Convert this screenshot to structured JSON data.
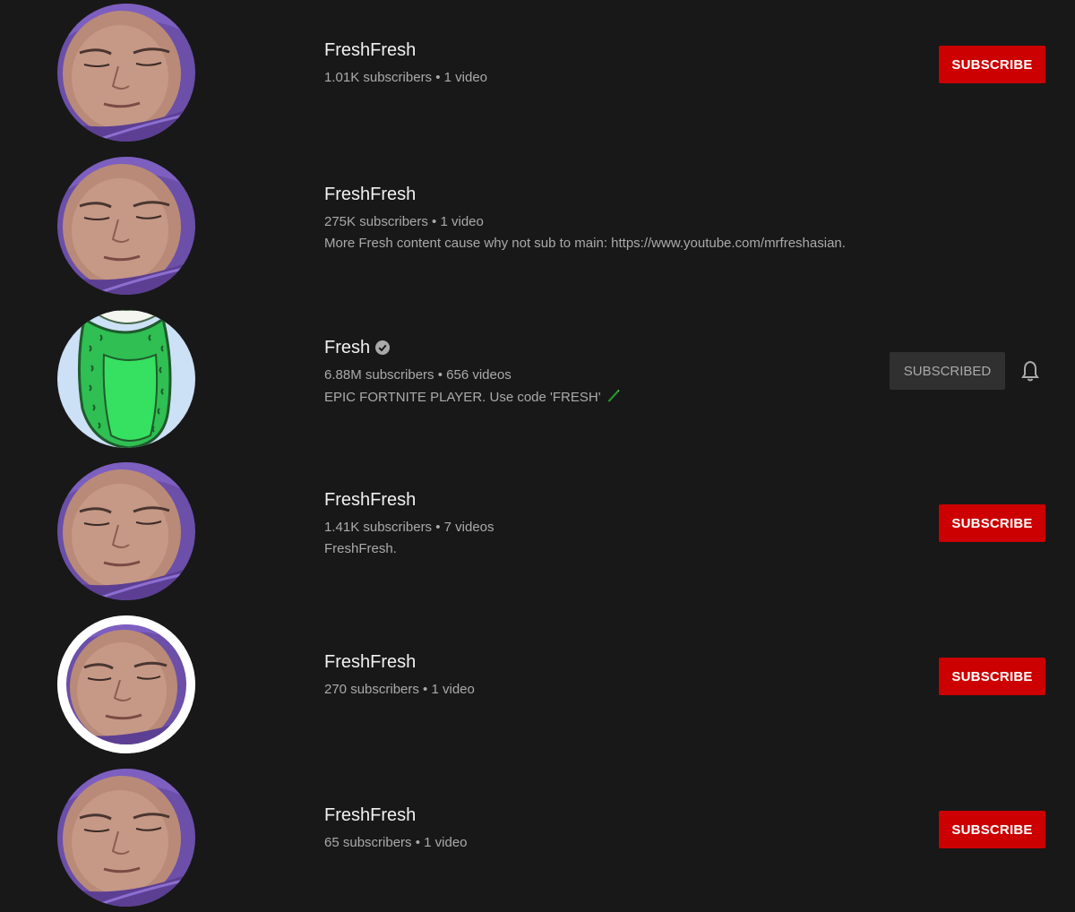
{
  "channels": [
    {
      "name": "FreshFresh",
      "meta": "1.01K subscribers • 1 video",
      "description": "",
      "button": "SUBSCRIBE",
      "avatar": "face-avatar"
    },
    {
      "name": "FreshFresh",
      "meta": "275K subscribers • 1 video",
      "description": "More Fresh content cause why not sub to main: https://www.youtube.com/mrfreshasian.",
      "button": "SUBSCRIBE",
      "avatar": "face-avatar"
    },
    {
      "name": "Fresh",
      "verified": true,
      "meta": "6.88M subscribers • 656 videos",
      "description": "EPIC FORTNITE PLAYER. Use code 'FRESH' ",
      "description_emoji": "cucumber-emoji",
      "button": "SUBSCRIBED",
      "bell": "bell-icon",
      "avatar": "pickle-avatar"
    },
    {
      "name": "FreshFresh",
      "meta": "1.41K subscribers • 7 videos",
      "description": "FreshFresh.",
      "button": "SUBSCRIBE",
      "avatar": "face-avatar"
    },
    {
      "name": "FreshFresh",
      "meta": "270 subscribers • 1 video",
      "description": "",
      "button": "SUBSCRIBE",
      "avatar": "face-avatar-white-ring"
    },
    {
      "name": "FreshFresh",
      "meta": "65 subscribers • 1 video",
      "description": "",
      "button": "SUBSCRIBE",
      "avatar": "face-avatar"
    }
  ],
  "colors": {
    "background": "#181818",
    "subscribe_red": "#cc0000",
    "subscribed_gray": "#303030",
    "text_primary": "#f1f1f1",
    "text_secondary": "#aaaaaa"
  }
}
